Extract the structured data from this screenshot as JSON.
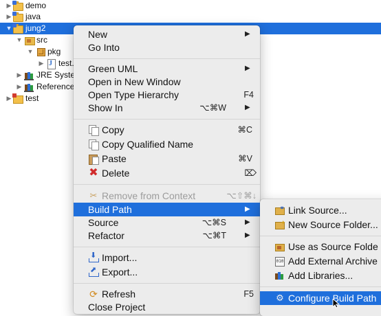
{
  "tree": {
    "items": [
      {
        "label": "demo",
        "icon": "java-project-icon",
        "expanded": false
      },
      {
        "label": "java",
        "icon": "java-project-icon",
        "expanded": false
      },
      {
        "label": "jung2",
        "icon": "java-project-icon",
        "expanded": true,
        "selected": true
      },
      {
        "label": "src",
        "icon": "source-folder-icon",
        "expanded": true
      },
      {
        "label": "pkg",
        "icon": "package-icon",
        "expanded": true
      },
      {
        "label": "test.",
        "icon": "java-file-icon",
        "expanded": false
      },
      {
        "label": "JRE Syste",
        "icon": "library-icon",
        "expanded": false
      },
      {
        "label": "Reference",
        "icon": "library-icon",
        "expanded": false
      },
      {
        "label": "test",
        "icon": "java-project-error-icon",
        "expanded": false
      }
    ]
  },
  "context_menu": {
    "items": [
      {
        "label": "New",
        "shortcut": "",
        "submenu": true
      },
      {
        "label": "Go Into",
        "shortcut": ""
      },
      {
        "label": "Green UML",
        "shortcut": "",
        "submenu": true
      },
      {
        "label": "Open in New Window",
        "shortcut": ""
      },
      {
        "label": "Open Type Hierarchy",
        "shortcut": "F4"
      },
      {
        "label": "Show In",
        "shortcut": "⌥⌘W",
        "submenu": true
      },
      {
        "label": "Copy",
        "shortcut": "⌘C",
        "icon": "copy-icon"
      },
      {
        "label": "Copy Qualified Name",
        "shortcut": "",
        "icon": "copy-qualified-name-icon"
      },
      {
        "label": "Paste",
        "shortcut": "⌘V",
        "icon": "paste-icon"
      },
      {
        "label": "Delete",
        "shortcut": "⌦",
        "icon": "delete-icon"
      },
      {
        "label": "Remove from Context",
        "shortcut": "⌥⇧⌘↓",
        "icon": "remove-context-icon",
        "disabled": true
      },
      {
        "label": "Build Path",
        "shortcut": "",
        "submenu": true,
        "highlighted": true
      },
      {
        "label": "Source",
        "shortcut": "⌥⌘S",
        "submenu": true
      },
      {
        "label": "Refactor",
        "shortcut": "⌥⌘T",
        "submenu": true
      },
      {
        "label": "Import...",
        "shortcut": "",
        "icon": "import-icon"
      },
      {
        "label": "Export...",
        "shortcut": "",
        "icon": "export-icon"
      },
      {
        "label": "Refresh",
        "shortcut": "F5",
        "icon": "refresh-icon"
      },
      {
        "label": "Close Project",
        "shortcut": ""
      }
    ]
  },
  "build_path_submenu": {
    "items": [
      {
        "label": "Link Source...",
        "icon": "link-source-icon"
      },
      {
        "label": "New Source Folder...",
        "icon": "new-source-folder-icon"
      },
      {
        "label": "Use as Source Folde",
        "icon": "use-as-source-folder-icon"
      },
      {
        "label": "Add External Archive",
        "icon": "external-archive-icon"
      },
      {
        "label": "Add Libraries...",
        "icon": "add-libraries-icon"
      },
      {
        "label": "Configure Build Path",
        "icon": "configure-build-path-icon",
        "highlighted": true
      }
    ]
  },
  "colors": {
    "selection": "#1f6fdc",
    "menu_background": "#ececec",
    "disabled_text": "#9c9c9c"
  },
  "submenu_arrow": "▶"
}
